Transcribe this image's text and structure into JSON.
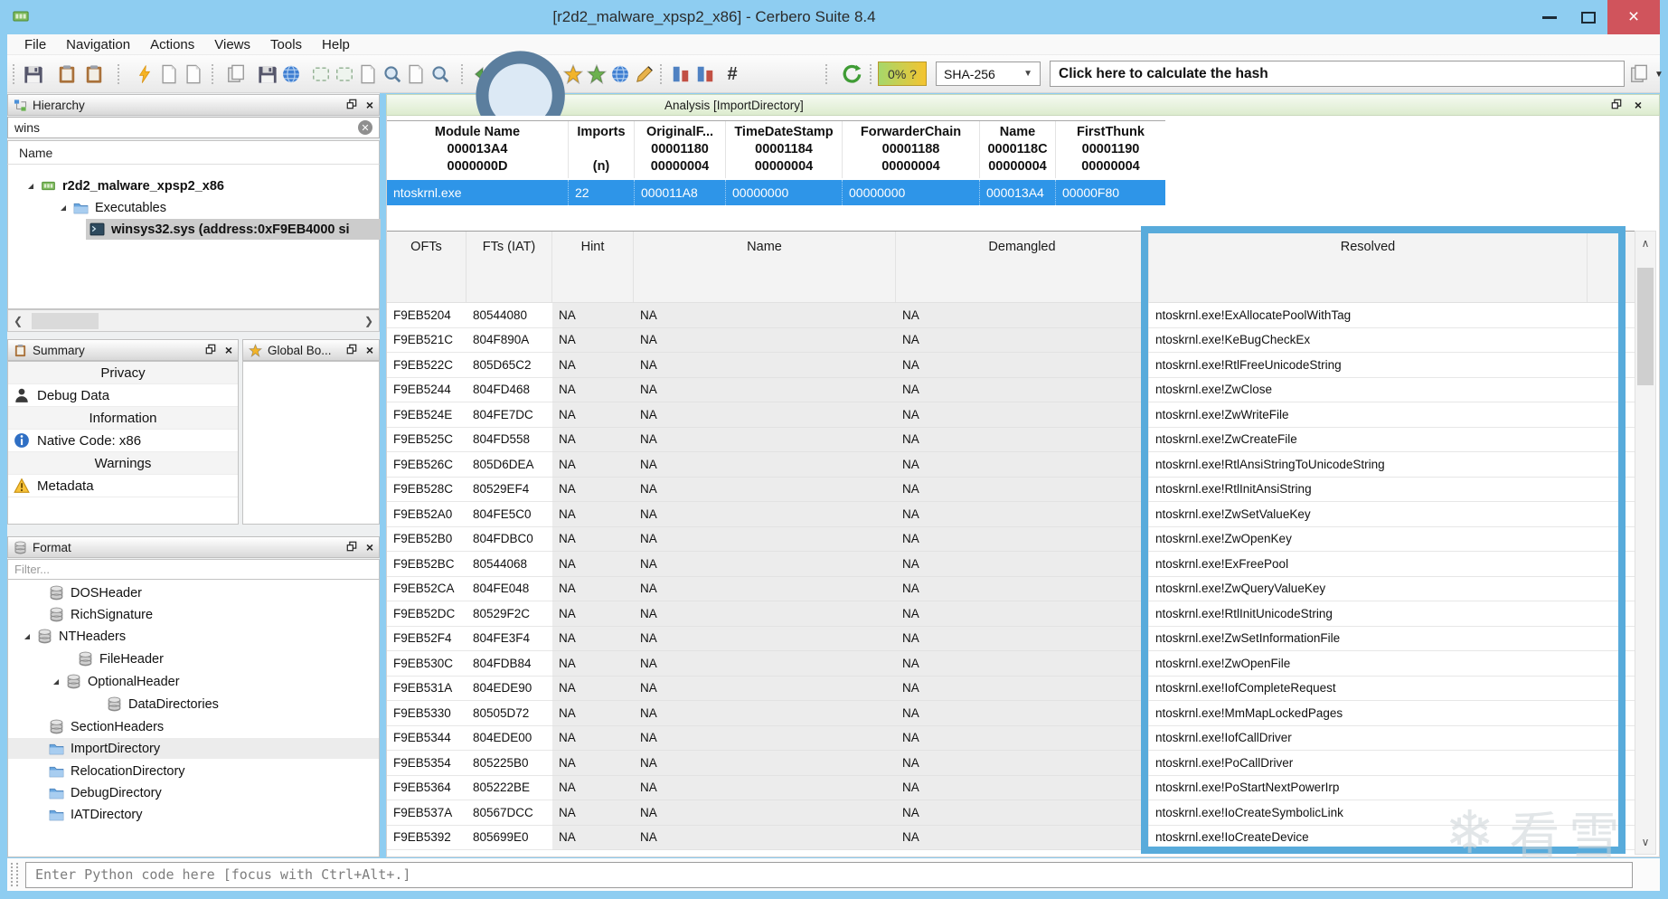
{
  "window": {
    "title": "[r2d2_malware_xpsp2_x86] - Cerbero Suite 8.4",
    "minimize_glyph": "",
    "close_glyph": "×"
  },
  "menu": {
    "items": [
      "File",
      "Navigation",
      "Actions",
      "Views",
      "Tools",
      "Help"
    ]
  },
  "toolbar": {
    "risk_badge": "0% ?",
    "hash_algo": "SHA-256",
    "hash_placeholder": "Click here to calculate the hash",
    "hash_symbol": "#"
  },
  "hierarchy": {
    "title": "Hierarchy",
    "search_value": "wins",
    "column_header": "Name",
    "items": [
      {
        "label": "r2d2_malware_xpsp2_x86"
      },
      {
        "label": "Executables"
      },
      {
        "label": "winsys32.sys (address:0xF9EB4000 si"
      }
    ]
  },
  "summary": {
    "title": "Summary",
    "rows": [
      {
        "type": "section",
        "label": "Privacy"
      },
      {
        "type": "item",
        "label": "Debug Data"
      },
      {
        "type": "section",
        "label": "Information"
      },
      {
        "type": "item",
        "label": "Native Code: x86"
      },
      {
        "type": "section",
        "label": "Warnings"
      },
      {
        "type": "item",
        "label": "Metadata"
      }
    ]
  },
  "global_bookmarks": {
    "title": "Global Bo..."
  },
  "format": {
    "title": "Format",
    "filter_placeholder": "Filter...",
    "items": [
      "DOSHeader",
      "RichSignature",
      "NTHeaders",
      "FileHeader",
      "OptionalHeader",
      "DataDirectories",
      "SectionHeaders",
      "ImportDirectory",
      "RelocationDirectory",
      "DebugDirectory",
      "IATDirectory"
    ]
  },
  "analysis": {
    "title": "Analysis [ImportDirectory]",
    "module_table": {
      "columns": [
        {
          "l1": "Module Name",
          "l2": "000013A4",
          "l3": "0000000D"
        },
        {
          "l1": "Imports",
          "l2": "",
          "l3": "(n)"
        },
        {
          "l1": "OriginalF...",
          "l2": "00001180",
          "l3": "00000004"
        },
        {
          "l1": "TimeDateStamp",
          "l2": "00001184",
          "l3": "00000004"
        },
        {
          "l1": "ForwarderChain",
          "l2": "00001188",
          "l3": "00000004"
        },
        {
          "l1": "Name",
          "l2": "0000118C",
          "l3": "00000004"
        },
        {
          "l1": "FirstThunk",
          "l2": "00001190",
          "l3": "00000004"
        }
      ],
      "selected_row": [
        "ntoskrnl.exe",
        "22",
        "000011A8",
        "00000000",
        "00000000",
        "000013A4",
        "00000F80"
      ]
    },
    "import_table": {
      "columns": [
        "OFTs",
        "FTs (IAT)",
        "Hint",
        "Name",
        "Demangled",
        "Resolved"
      ],
      "rows": [
        {
          "oft": "F9EB5204",
          "ft": "80544080",
          "hint": "NA",
          "name": "NA",
          "demangled": "NA",
          "resolved": "ntoskrnl.exe!ExAllocatePoolWithTag"
        },
        {
          "oft": "F9EB521C",
          "ft": "804F890A",
          "hint": "NA",
          "name": "NA",
          "demangled": "NA",
          "resolved": "ntoskrnl.exe!KeBugCheckEx"
        },
        {
          "oft": "F9EB522C",
          "ft": "805D65C2",
          "hint": "NA",
          "name": "NA",
          "demangled": "NA",
          "resolved": "ntoskrnl.exe!RtlFreeUnicodeString"
        },
        {
          "oft": "F9EB5244",
          "ft": "804FD468",
          "hint": "NA",
          "name": "NA",
          "demangled": "NA",
          "resolved": "ntoskrnl.exe!ZwClose"
        },
        {
          "oft": "F9EB524E",
          "ft": "804FE7DC",
          "hint": "NA",
          "name": "NA",
          "demangled": "NA",
          "resolved": "ntoskrnl.exe!ZwWriteFile"
        },
        {
          "oft": "F9EB525C",
          "ft": "804FD558",
          "hint": "NA",
          "name": "NA",
          "demangled": "NA",
          "resolved": "ntoskrnl.exe!ZwCreateFile"
        },
        {
          "oft": "F9EB526C",
          "ft": "805D6DEA",
          "hint": "NA",
          "name": "NA",
          "demangled": "NA",
          "resolved": "ntoskrnl.exe!RtlAnsiStringToUnicodeString"
        },
        {
          "oft": "F9EB528C",
          "ft": "80529EF4",
          "hint": "NA",
          "name": "NA",
          "demangled": "NA",
          "resolved": "ntoskrnl.exe!RtlInitAnsiString"
        },
        {
          "oft": "F9EB52A0",
          "ft": "804FE5C0",
          "hint": "NA",
          "name": "NA",
          "demangled": "NA",
          "resolved": "ntoskrnl.exe!ZwSetValueKey"
        },
        {
          "oft": "F9EB52B0",
          "ft": "804FDBC0",
          "hint": "NA",
          "name": "NA",
          "demangled": "NA",
          "resolved": "ntoskrnl.exe!ZwOpenKey"
        },
        {
          "oft": "F9EB52BC",
          "ft": "80544068",
          "hint": "NA",
          "name": "NA",
          "demangled": "NA",
          "resolved": "ntoskrnl.exe!ExFreePool"
        },
        {
          "oft": "F9EB52CA",
          "ft": "804FE048",
          "hint": "NA",
          "name": "NA",
          "demangled": "NA",
          "resolved": "ntoskrnl.exe!ZwQueryValueKey"
        },
        {
          "oft": "F9EB52DC",
          "ft": "80529F2C",
          "hint": "NA",
          "name": "NA",
          "demangled": "NA",
          "resolved": "ntoskrnl.exe!RtlInitUnicodeString"
        },
        {
          "oft": "F9EB52F4",
          "ft": "804FE3F4",
          "hint": "NA",
          "name": "NA",
          "demangled": "NA",
          "resolved": "ntoskrnl.exe!ZwSetInformationFile"
        },
        {
          "oft": "F9EB530C",
          "ft": "804FDB84",
          "hint": "NA",
          "name": "NA",
          "demangled": "NA",
          "resolved": "ntoskrnl.exe!ZwOpenFile"
        },
        {
          "oft": "F9EB531A",
          "ft": "804EDE90",
          "hint": "NA",
          "name": "NA",
          "demangled": "NA",
          "resolved": "ntoskrnl.exe!IofCompleteRequest"
        },
        {
          "oft": "F9EB5330",
          "ft": "80505D72",
          "hint": "NA",
          "name": "NA",
          "demangled": "NA",
          "resolved": "ntoskrnl.exe!MmMapLockedPages"
        },
        {
          "oft": "F9EB5344",
          "ft": "804EDE00",
          "hint": "NA",
          "name": "NA",
          "demangled": "NA",
          "resolved": "ntoskrnl.exe!IofCallDriver"
        },
        {
          "oft": "F9EB5354",
          "ft": "805225B0",
          "hint": "NA",
          "name": "NA",
          "demangled": "NA",
          "resolved": "ntoskrnl.exe!PoCallDriver"
        },
        {
          "oft": "F9EB5364",
          "ft": "805222BE",
          "hint": "NA",
          "name": "NA",
          "demangled": "NA",
          "resolved": "ntoskrnl.exe!PoStartNextPowerIrp"
        },
        {
          "oft": "F9EB537A",
          "ft": "80567DCC",
          "hint": "NA",
          "name": "NA",
          "demangled": "NA",
          "resolved": "ntoskrnl.exe!IoCreateSymbolicLink"
        },
        {
          "oft": "F9EB5392",
          "ft": "805699E0",
          "hint": "NA",
          "name": "NA",
          "demangled": "NA",
          "resolved": "ntoskrnl.exe!IoCreateDevice"
        }
      ]
    }
  },
  "python_bar": {
    "placeholder": "Enter Python code here [focus with Ctrl+Alt+.]"
  },
  "watermark": {
    "snowflake": "❄",
    "text": "看雪"
  },
  "colors": {
    "titlebar": "#8ecdf1",
    "close_button": "#d0545c",
    "selected_row": "#2e95e8",
    "highlight_rect": "#58abdb",
    "risk_badge_left": "#a6d76b",
    "risk_badge_right": "#f4c430"
  }
}
